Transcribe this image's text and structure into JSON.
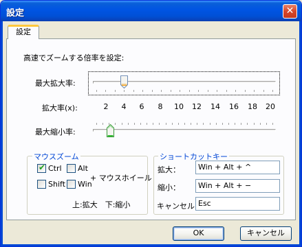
{
  "window": {
    "title": "設定",
    "close_glyph": "✕"
  },
  "tab": {
    "label": "設定"
  },
  "heading": "高速でズームする倍率を設定:",
  "max_zoom": {
    "label": "最大拡大率:",
    "value": 4,
    "min": 1,
    "max": 20
  },
  "scale": {
    "label": "拡大率(x):",
    "numbers": [
      "2",
      "4",
      "6",
      "8",
      "10",
      "12",
      "14",
      "16",
      "18",
      "20"
    ]
  },
  "max_shrink": {
    "label": "最大縮小率:",
    "value_fraction": 0.08
  },
  "mouse_zoom": {
    "title": "マウスズーム",
    "checkboxes": [
      {
        "label": "Ctrl",
        "checked": true
      },
      {
        "label": "Alt",
        "checked": false
      },
      {
        "label": "Shift",
        "checked": false
      },
      {
        "label": "Win",
        "checked": false
      }
    ],
    "plus_wheel": "+ マウスホイール",
    "hint": "上:拡大　下:縮小"
  },
  "shortcut": {
    "title": "ショートカットキー",
    "rows": [
      {
        "label": "拡大：",
        "value": "Win + Alt + ^"
      },
      {
        "label": "縮小：",
        "value": "Win + Alt + −"
      },
      {
        "label": "キャンセル：",
        "value": "Esc"
      }
    ]
  },
  "buttons": {
    "ok": "OK",
    "cancel": "キャンセル"
  },
  "colors": {
    "title_bar": "#0054e3",
    "group_title": "#0046d5",
    "tab_highlight": "#ffc83c"
  }
}
